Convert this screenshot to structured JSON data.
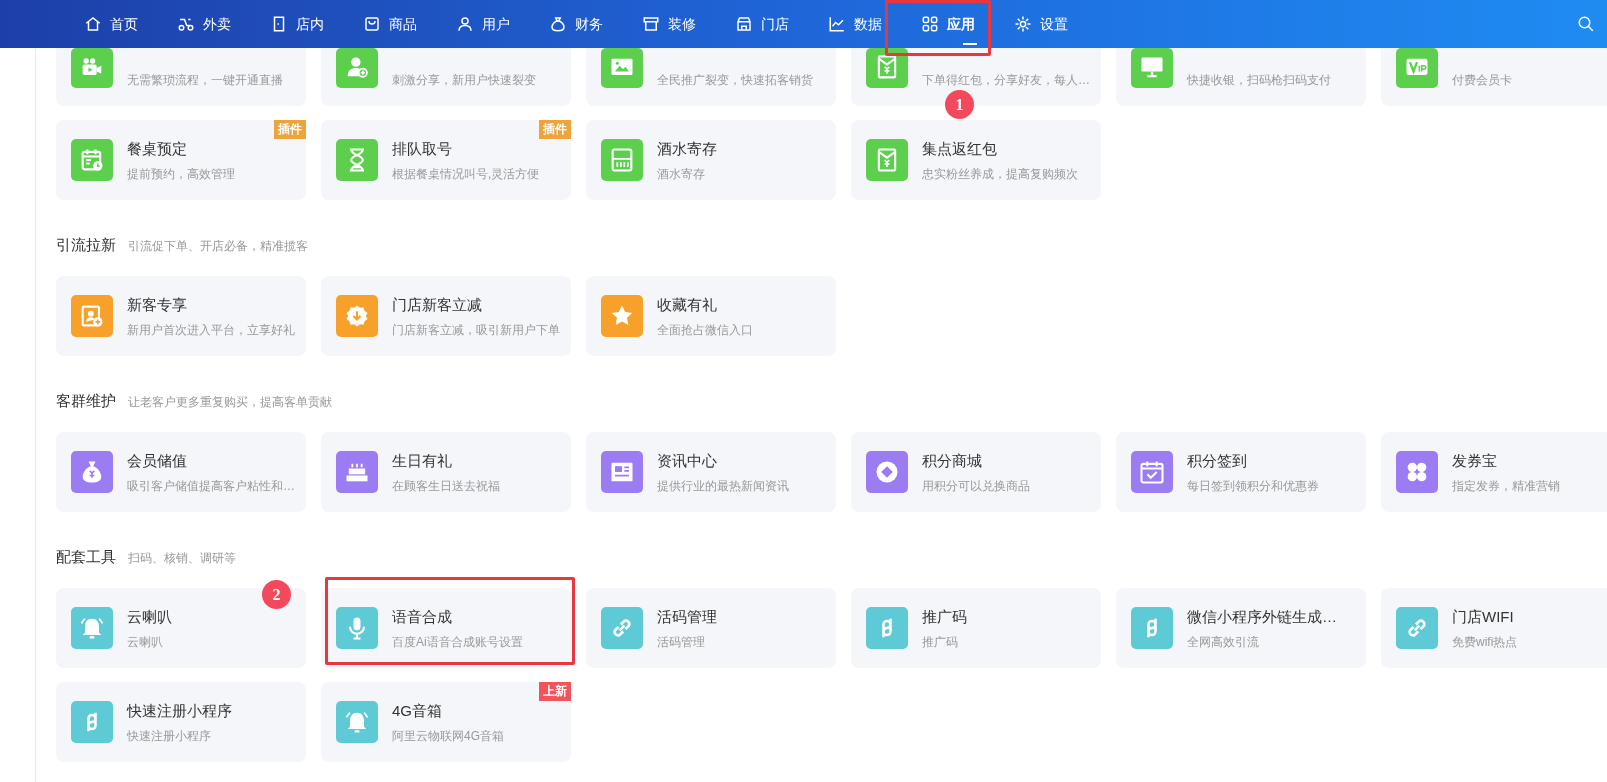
{
  "nav": [
    {
      "label": "首页",
      "selected": false,
      "highlighted": false
    },
    {
      "label": "外卖",
      "selected": false,
      "highlighted": false
    },
    {
      "label": "店内",
      "selected": false,
      "highlighted": false
    },
    {
      "label": "商品",
      "selected": false,
      "highlighted": false
    },
    {
      "label": "用户",
      "selected": false,
      "highlighted": false
    },
    {
      "label": "财务",
      "selected": false,
      "highlighted": false
    },
    {
      "label": "装修",
      "selected": false,
      "highlighted": false
    },
    {
      "label": "门店",
      "selected": false,
      "highlighted": false
    },
    {
      "label": "数据",
      "selected": false,
      "highlighted": false
    },
    {
      "label": "应用",
      "selected": true,
      "highlighted": true
    },
    {
      "label": "设置",
      "selected": false,
      "highlighted": false
    }
  ],
  "sections": [
    {
      "cards": [
        {
          "desc": "无需繁琐流程，一键开通直播"
        },
        {
          "desc": "刺激分享，新用户快速裂变"
        },
        {
          "desc": "全民推广裂变，快速拓客销货"
        },
        {
          "desc": "下单得红包，分享好友，每人…",
          "callout": "1"
        },
        {
          "desc": "快捷收银，扫码枪扫码支付"
        },
        {
          "desc": "付费会员卡"
        },
        {
          "title": "餐桌预定",
          "desc": "提前预约，高效管理",
          "tag": {
            "text": "插件",
            "kind": "plugin"
          }
        },
        {
          "title": "排队取号",
          "desc": "根据餐桌情况叫号,灵活方便",
          "tag": {
            "text": "插件",
            "kind": "plugin"
          }
        },
        {
          "title": "酒水寄存",
          "desc": "酒水寄存"
        },
        {
          "title": "集点返红包",
          "desc": "忠实粉丝养成，提高复购频次"
        }
      ]
    },
    {
      "title": "引流拉新",
      "subtitle": "引流促下单、开店必备，精准揽客",
      "cards": [
        {
          "title": "新客专享",
          "desc": "新用户首次进入平台，立享好礼"
        },
        {
          "title": "门店新客立减",
          "desc": "门店新客立减，吸引新用户下单"
        },
        {
          "title": "收藏有礼",
          "desc": "全面抢占微信入口"
        }
      ]
    },
    {
      "title": "客群维护",
      "subtitle": "让老客户更多重复购买，提高客单贡献",
      "cards": [
        {
          "title": "会员储值",
          "desc": "吸引客户储值提高客户粘性和…"
        },
        {
          "title": "生日有礼",
          "desc": "在顾客生日送去祝福"
        },
        {
          "title": "资讯中心",
          "desc": "提供行业的最热新闻资讯"
        },
        {
          "title": "积分商城",
          "desc": "用积分可以兑换商品"
        },
        {
          "title": "积分签到",
          "desc": "每日签到领积分和优惠券"
        },
        {
          "title": "发券宝",
          "desc": "指定发券，精准营销"
        }
      ]
    },
    {
      "title": "配套工具",
      "subtitle": "扫码、核销、调研等",
      "cards": [
        {
          "title": "云喇叭",
          "desc": "云喇叭",
          "callout": "2"
        },
        {
          "title": "语音合成",
          "desc": "百度Ai语音合成账号设置",
          "highlighted": true
        },
        {
          "title": "活码管理",
          "desc": "活码管理"
        },
        {
          "title": "推广码",
          "desc": "推广码"
        },
        {
          "title": "微信小程序外链生成…",
          "desc": "全网高效引流"
        },
        {
          "title": "门店WIFI",
          "desc": "免费wifi热点"
        },
        {
          "title": "快速注册小程序",
          "desc": "快速注册小程序"
        },
        {
          "title": "4G音箱",
          "desc": "阿里云物联网4G音箱",
          "tag": {
            "text": "上新",
            "kind": "new"
          }
        }
      ]
    }
  ]
}
